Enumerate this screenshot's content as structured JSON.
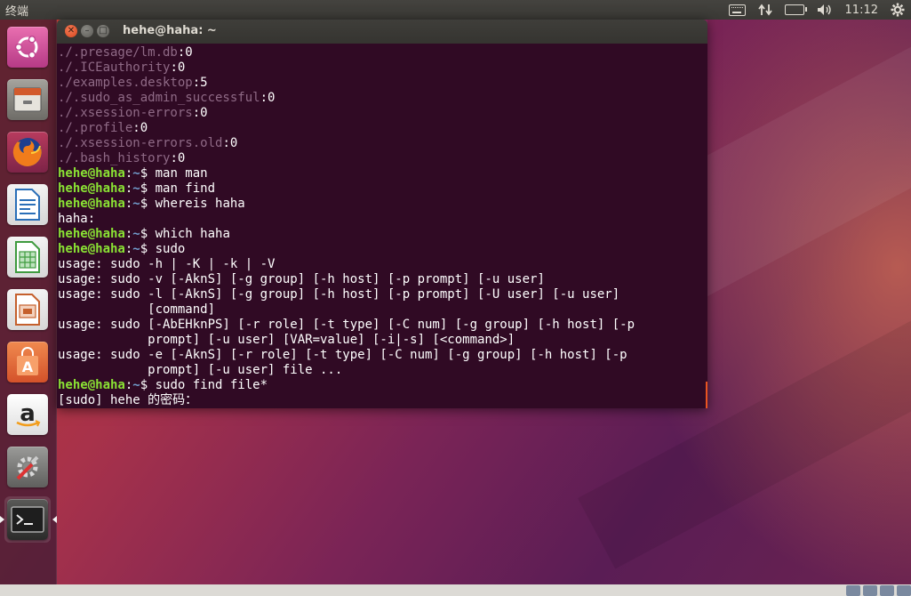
{
  "top_panel": {
    "app_title": "终端",
    "clock": "11:12",
    "tray_icons": [
      "keyboard-icon",
      "network-icon",
      "battery-icon",
      "volume-icon",
      "settings-gear-icon"
    ]
  },
  "launcher": {
    "items": [
      {
        "name": "ubuntu-dash",
        "icon": "ubuntu-logo-icon",
        "color": "#e05a9b"
      },
      {
        "name": "files",
        "icon": "file-cabinet-icon",
        "color": "#8c8a84"
      },
      {
        "name": "firefox",
        "icon": "firefox-icon",
        "color": "#e66000"
      },
      {
        "name": "libreoffice-writer",
        "icon": "writer-doc-icon",
        "color": "#2a6fb8"
      },
      {
        "name": "libreoffice-calc",
        "icon": "calc-sheet-icon",
        "color": "#3f9b3f"
      },
      {
        "name": "libreoffice-impress",
        "icon": "impress-slide-icon",
        "color": "#c5602d"
      },
      {
        "name": "ubuntu-software",
        "icon": "shopping-bag-icon",
        "color": "#e4682b"
      },
      {
        "name": "amazon",
        "icon": "amazon-icon",
        "color": "#f2f2f2"
      },
      {
        "name": "system-settings",
        "icon": "wrench-gear-icon",
        "color": "#7b7b7b"
      },
      {
        "name": "terminal",
        "icon": "terminal-icon",
        "color": "#2d2d2d"
      }
    ],
    "amazon_letter": "a",
    "impress_letter": "A"
  },
  "terminal": {
    "title": "hehe@haha: ~",
    "prompt_user": "hehe@haha",
    "prompt_sep": ":",
    "prompt_path": "~",
    "prompt_sym": "$ ",
    "lines": [
      {
        "type": "out",
        "path": "./.presage/lm.db",
        "val": ":0"
      },
      {
        "type": "out",
        "path": "./.ICEauthority",
        "val": ":0"
      },
      {
        "type": "out",
        "path": "./examples.desktop",
        "val": ":5"
      },
      {
        "type": "out",
        "path": "./.sudo_as_admin_successful",
        "val": ":0"
      },
      {
        "type": "out",
        "path": "./.xsession-errors",
        "val": ":0"
      },
      {
        "type": "out",
        "path": "./.profile",
        "val": ":0"
      },
      {
        "type": "out",
        "path": "./.xsession-errors.old",
        "val": ":0"
      },
      {
        "type": "out",
        "path": "./.bash_history",
        "val": ":0"
      },
      {
        "type": "cmd",
        "text": "man man"
      },
      {
        "type": "cmd",
        "text": "man find"
      },
      {
        "type": "cmd",
        "text": "whereis haha"
      },
      {
        "type": "plain",
        "text": "haha:"
      },
      {
        "type": "cmd",
        "text": "which haha"
      },
      {
        "type": "cmd",
        "text": "sudo"
      },
      {
        "type": "plain",
        "text": "usage: sudo -h | -K | -k | -V"
      },
      {
        "type": "plain",
        "text": "usage: sudo -v [-AknS] [-g group] [-h host] [-p prompt] [-u user]"
      },
      {
        "type": "plain",
        "text": "usage: sudo -l [-AknS] [-g group] [-h host] [-p prompt] [-U user] [-u user]"
      },
      {
        "type": "plain",
        "text": "            [command]"
      },
      {
        "type": "plain",
        "text": "usage: sudo [-AbEHknPS] [-r role] [-t type] [-C num] [-g group] [-h host] [-p"
      },
      {
        "type": "plain",
        "text": "            prompt] [-u user] [VAR=value] [-i|-s] [<command>]"
      },
      {
        "type": "plain",
        "text": "usage: sudo -e [-AknS] [-r role] [-t type] [-C num] [-g group] [-h host] [-p"
      },
      {
        "type": "plain",
        "text": "            prompt] [-u user] file ..."
      },
      {
        "type": "cmd",
        "text": "sudo find file*"
      },
      {
        "type": "plain",
        "text": "[sudo] hehe 的密码："
      }
    ]
  },
  "colors": {
    "terminal_bg": "#300a24",
    "prompt_green": "#8ae234",
    "path_blue": "#729fcf",
    "accent_orange": "#e95420"
  }
}
